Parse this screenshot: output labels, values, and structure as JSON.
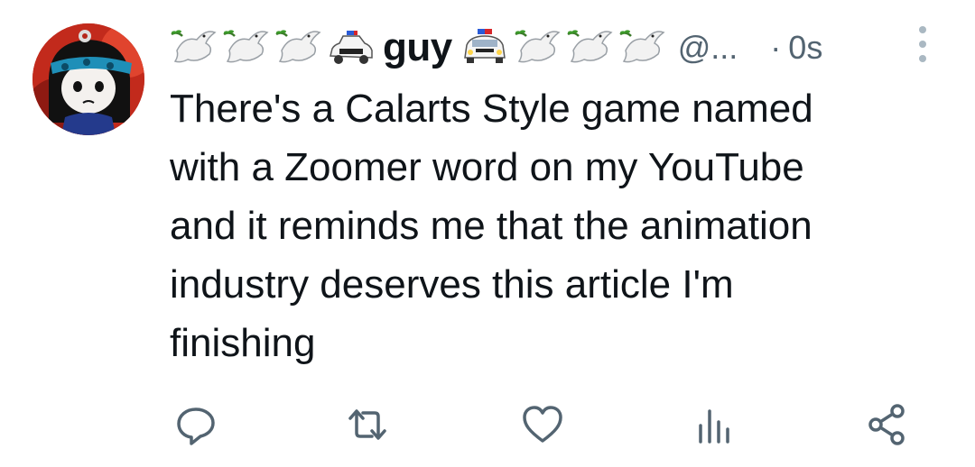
{
  "author": {
    "display_name": "guy",
    "handle": "@...",
    "name_emoji_before": [
      "dove-with-olive-branch",
      "dove-with-olive-branch",
      "dove-with-olive-branch",
      "police-car"
    ],
    "name_emoji_after": [
      "oncoming-police-car",
      "dove-with-olive-branch",
      "dove-with-olive-branch",
      "dove-with-olive-branch"
    ],
    "avatar_icon": "cartoon-character-avatar"
  },
  "meta": {
    "separator": "·",
    "timestamp": "0s"
  },
  "tweet": {
    "text": "There's a Calarts Style game named\nwith a Zoomer word on my YouTube\nand it reminds me that the animation\nindustry deserves this article I'm\nfinishing"
  },
  "actions": [
    {
      "name": "reply",
      "icon": "reply-icon"
    },
    {
      "name": "retweet",
      "icon": "retweet-icon"
    },
    {
      "name": "like",
      "icon": "heart-icon"
    },
    {
      "name": "views",
      "icon": "views-icon"
    },
    {
      "name": "share",
      "icon": "share-icon"
    }
  ],
  "colors": {
    "text": "#0f1419",
    "secondary": "#536471",
    "icon": "#536471"
  }
}
